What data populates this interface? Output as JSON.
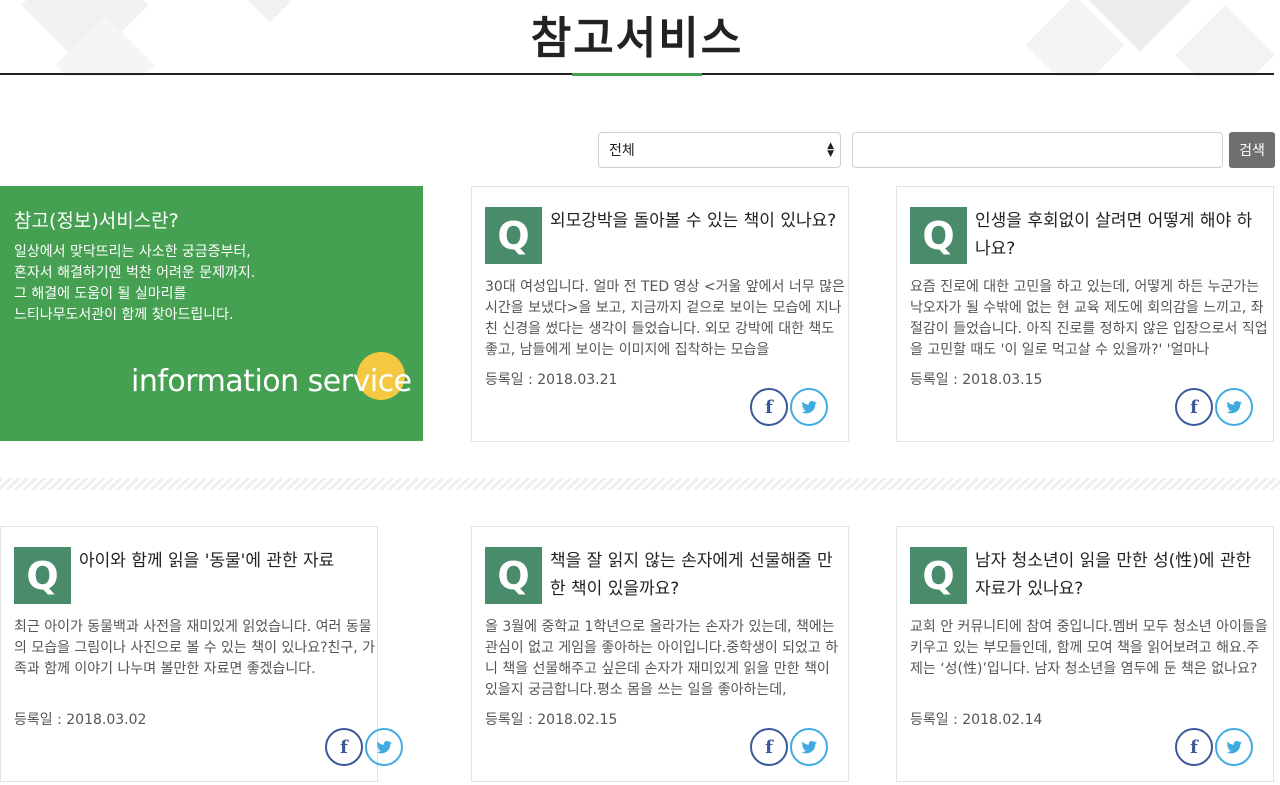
{
  "header": {
    "title": "참고서비스"
  },
  "search": {
    "category_selected": "전체",
    "query_value": "",
    "button_label": "검색"
  },
  "intro": {
    "heading": "참고(정보)서비스란?",
    "lines": [
      "일상에서 맞닥뜨리는 사소한 궁금증부터,",
      "혼자서 해결하기엔 벅찬 어려운 문제까지.",
      "그 해결에 도움이 될 실마리를",
      "느티나무도서관이 함께 찾아드립니다."
    ],
    "tagline": "information service"
  },
  "qa": {
    "icon_letter": "Q",
    "facebook_glyph": "f",
    "cards": [
      {
        "title": "외모강박을 돌아볼 수 있는 책이 있나요?",
        "body": "30대 여성입니다. 얼마 전 TED 영상 <거울 앞에서 너무 많은 시간을 보냈다>을 보고, 지금까지 겉으로 보이는 모습에 지나친 신경을 썼다는 생각이 들었습니다. 외모 강박에 대한 책도 좋고, 남들에게 보이는 이미지에 집착하는 모습을",
        "date": "등록일 : 2018.03.21"
      },
      {
        "title": "인생을 후회없이 살려면 어떻게 해야 하나요?",
        "body": "요즘 진로에 대한 고민을 하고 있는데, 어떻게 하든 누군가는 낙오자가 될 수밖에 없는 현 교육 제도에 회의감을 느끼고, 좌절감이 들었습니다. 아직 진로를 정하지 않은 입장으로서 직업을 고민할 때도 '이 일로 먹고살 수 있을까?' '얼마나",
        "date": "등록일 : 2018.03.15"
      },
      {
        "title": "아이와 함께 읽을 '동물'에 관한 자료",
        "body": "최근 아이가 동물백과 사전을 재미있게 읽었습니다.  여러 동물의 모습을 그림이나 사진으로 볼 수 있는 책이 있나요?친구, 가족과 함께 이야기 나누며 볼만한 자료면 좋겠습니다.",
        "date": "등록일 : 2018.03.02"
      },
      {
        "title": "책을 잘 읽지 않는 손자에게 선물해줄 만한 책이 있을까요?",
        "body": "올 3월에 중학교 1학년으로 올라가는 손자가 있는데, 책에는 관심이 없고 게임을 좋아하는 아이입니다.중학생이 되었고 하니 책을 선물해주고 싶은데 손자가 재미있게 읽을 만한 책이 있을지 궁금합니다.평소 몸을 쓰는 일을 좋아하는데,",
        "date": "등록일 : 2018.02.15"
      },
      {
        "title": "남자 청소년이 읽을 만한 성(性)에 관한 자료가 있나요?",
        "body": "교회 안 커뮤니티에 참여 중입니다.멤버 모두 청소년 아이들을 키우고 있는 부모들인데, 함께 모여 책을 읽어보려고 해요.주제는 ‘성(性)’입니다. 남자 청소년을 염두에 둔 책은 없나요?",
        "date": "등록일 : 2018.02.14"
      }
    ]
  },
  "colors": {
    "brand_green": "#46a052",
    "q_icon": "#4a8b6b",
    "badge_yellow": "#f5c842",
    "facebook": "#3b5998",
    "twitter": "#41abe1"
  },
  "icons": [
    "facebook-icon",
    "twitter-icon",
    "select-arrow-icon",
    "q-icon"
  ]
}
